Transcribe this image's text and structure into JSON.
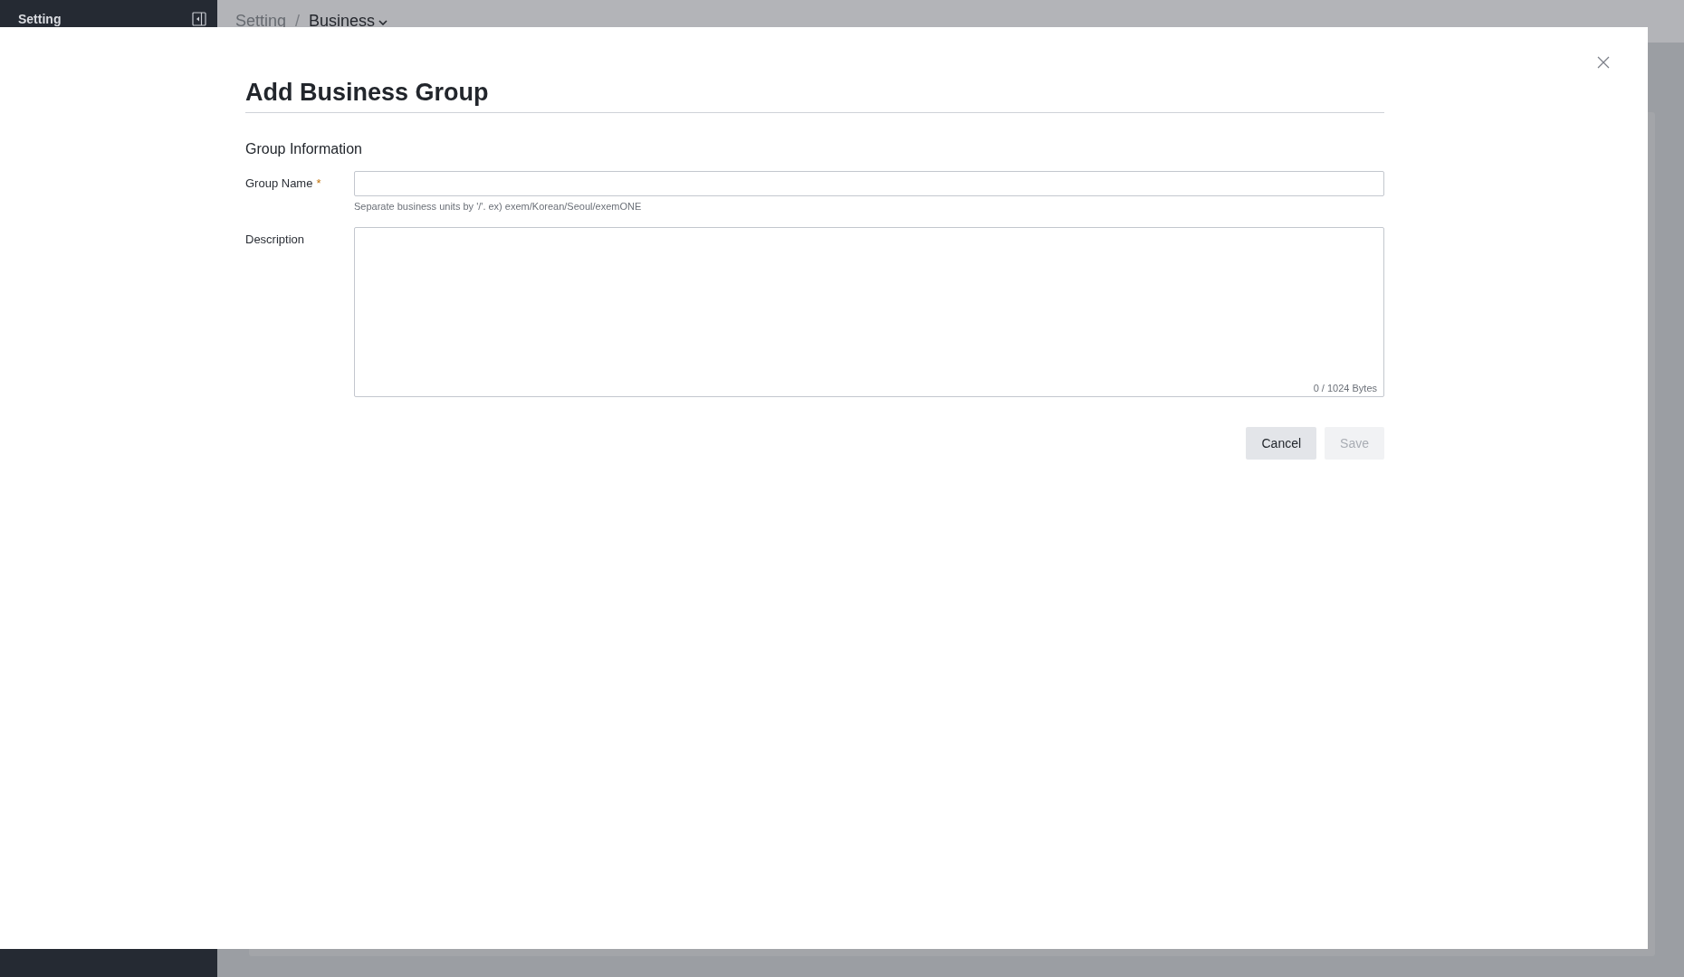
{
  "sidebar": {
    "title": "Setting"
  },
  "breadcrumb": {
    "separator": "/",
    "items": [
      {
        "label": "Setting",
        "current": false,
        "dropdown": false
      },
      {
        "label": "Business",
        "current": true,
        "dropdown": true
      }
    ]
  },
  "dialog": {
    "title": "Add Business Group",
    "section_title": "Group Information",
    "fields": [
      {
        "kind": "input",
        "label": "Group Name",
        "required_mark": "*",
        "hint": "Separate business units by '/'. ex) exem/Korean/Seoul/exemONE"
      },
      {
        "kind": "textarea",
        "label": "Description",
        "counter": "0 / 1024 Bytes"
      }
    ],
    "buttons": [
      {
        "label": "Cancel",
        "disabled": false
      },
      {
        "label": "Save",
        "disabled": true
      }
    ]
  }
}
